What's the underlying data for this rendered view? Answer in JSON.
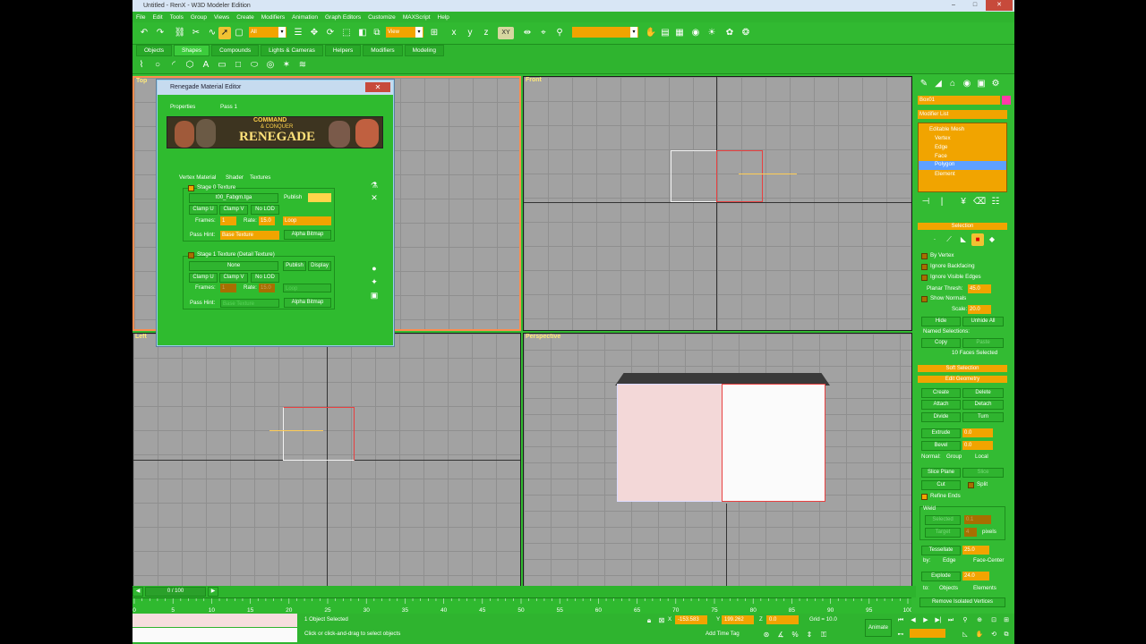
{
  "window": {
    "title": "Untitled - RenX - W3D Modeler Edition"
  },
  "menu": [
    "File",
    "Edit",
    "Tools",
    "Group",
    "Views",
    "Create",
    "Modifiers",
    "Animation",
    "Graph Editors",
    "Customize",
    "MAXScript",
    "Help"
  ],
  "toolbar": {
    "selection_filter": "All",
    "ref_coord": "View",
    "axis": "XY"
  },
  "tabs": [
    "Objects",
    "Shapes",
    "Compounds",
    "Lights & Cameras",
    "Helpers",
    "Modifiers",
    "Modeling"
  ],
  "active_tab": "Shapes",
  "viewports": {
    "top": "Top",
    "front": "Front",
    "left": "Left",
    "perspective": "Perspective"
  },
  "dialog": {
    "title": "Renegade Material Editor",
    "tabs": [
      "Properties",
      "Pass 1"
    ],
    "sub_tabs": [
      "Vertex Material",
      "Shader",
      "Textures"
    ],
    "stage0": {
      "label": "Stage 0 Texture",
      "texture": "t00_Fabgm.tga",
      "publish": "Publish",
      "clamp_u": "Clamp U",
      "clamp_v": "Clamp V",
      "no_lod": "No LOD",
      "frames_label": "Frames:",
      "frames": "1",
      "rate_label": "Rate:",
      "rate": "15.0",
      "mode": "Loop",
      "pass_hint_label": "Pass Hint:",
      "pass_hint": "Base Texture",
      "alpha_bitmap": "Alpha Bitmap"
    },
    "stage1": {
      "label": "Stage 1 Texture (Detail Texture)",
      "texture": "None",
      "publish": "Publish",
      "display": "Display",
      "clamp_u": "Clamp U",
      "clamp_v": "Clamp V",
      "no_lod": "No LOD",
      "frames_label": "Frames:",
      "frames": "1",
      "rate_label": "Rate:",
      "rate": "15.0",
      "mode": "Loop",
      "pass_hint_label": "Pass Hint:",
      "pass_hint": "Base Texture",
      "alpha_bitmap": "Alpha Bitmap"
    },
    "banner": {
      "top": "COMMAND",
      "mid": "& CONQUER",
      "main": "RENEGADE"
    }
  },
  "command_panel": {
    "object_name": "Box01",
    "modifier_list": "Modifier List",
    "stack": [
      "Editable Mesh",
      "Vertex",
      "Edge",
      "Face",
      "Polygon",
      "Element"
    ],
    "selected_stack": "Polygon",
    "selection_rollout": "Selection",
    "by_vertex": "By Vertex",
    "ignore_backfacing": "Ignore Backfacing",
    "ignore_visible_edges": "Ignore Visible Edges",
    "planar_thresh_label": "Planar Thresh:",
    "planar_thresh": "45.0",
    "show_normals": "Show Normals",
    "scale_label": "Scale:",
    "scale": "20.0",
    "hide": "Hide",
    "unhide_all": "Unhide All",
    "named_selections": "Named Selections:",
    "copy": "Copy",
    "paste": "Paste",
    "faces_selected": "10 Faces Selected",
    "soft_selection": "Soft Selection",
    "edit_geometry": "Edit Geometry",
    "create": "Create",
    "delete": "Delete",
    "attach": "Attach",
    "detach": "Detach",
    "divide": "Divide",
    "turn": "Turn",
    "extrude_label": "Extrude",
    "extrude": "0.0",
    "bevel_label": "Bevel",
    "bevel": "0.0",
    "normal_label": "Normal:",
    "group": "Group",
    "local": "Local",
    "slice_plane": "Slice Plane",
    "slice": "Slice",
    "cut": "Cut",
    "split": "Split",
    "refine_ends": "Refine Ends",
    "weld": "Weld",
    "selected": "Selected",
    "weld_sel_val": "0.1",
    "target": "Target",
    "weld_target_val": "4",
    "pixels": "pixels",
    "tessellate": "Tessellate",
    "tessellate_val": "25.0",
    "by_label": "by:",
    "edge": "Edge",
    "face_center": "Face-Center",
    "explode": "Explode",
    "explode_val": "24.0",
    "to_label": "to:",
    "objects": "Objects",
    "elements": "Elements",
    "remove_isolated": "Remove Isolated Vertices"
  },
  "timeline": {
    "frame": "0 / 100"
  },
  "ruler_ticks": [
    "0",
    "5",
    "10",
    "15",
    "20",
    "25",
    "30",
    "35",
    "40",
    "45",
    "50",
    "55",
    "60",
    "65",
    "70",
    "75",
    "80",
    "85",
    "90",
    "95",
    "100"
  ],
  "status": {
    "selected": "1 Object Selected",
    "prompt": "Click or click-and-drag to select objects",
    "x": "-153.583",
    "y": "199.262",
    "z": "0.0",
    "grid": "Grid = 10.0",
    "add_time_tag": "Add Time Tag",
    "animate": "Animate"
  }
}
